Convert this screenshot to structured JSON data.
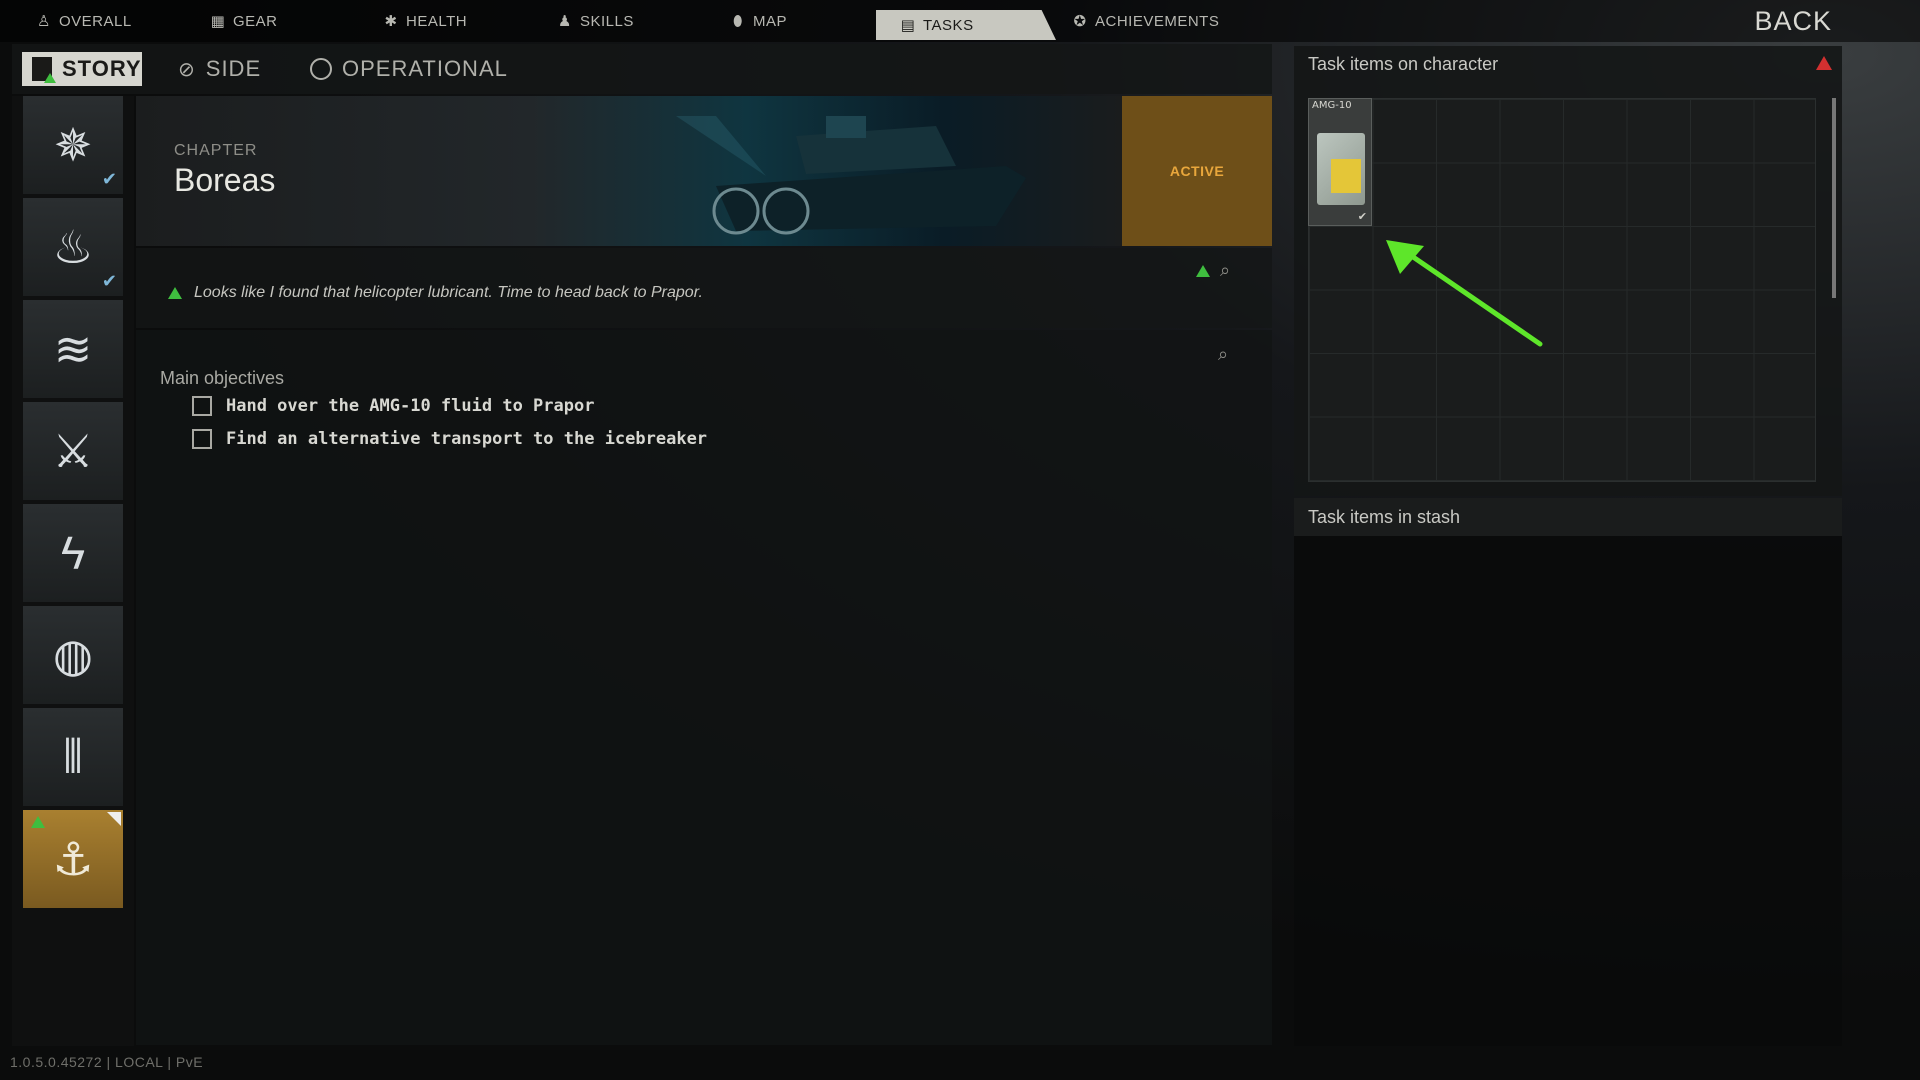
{
  "topnav": {
    "tabs": [
      {
        "label": "OVERALL",
        "icon": "person-icon"
      },
      {
        "label": "GEAR",
        "icon": "gear-vest-icon"
      },
      {
        "label": "HEALTH",
        "icon": "health-icon"
      },
      {
        "label": "SKILLS",
        "icon": "skills-icon"
      },
      {
        "label": "MAP",
        "icon": "map-pin-icon"
      },
      {
        "label": "TASKS",
        "icon": "tasks-icon",
        "active": true
      },
      {
        "label": "ACHIEVEMENTS",
        "icon": "achievements-icon"
      }
    ],
    "back_label": "BACK"
  },
  "subtabs": {
    "story": "STORY",
    "side": "SIDE",
    "operational": "OPERATIONAL"
  },
  "sidebar": {
    "traders": [
      {
        "icon": "compass-star-icon",
        "completed": true
      },
      {
        "icon": "flame-icon",
        "completed": true
      },
      {
        "icon": "wave-icon"
      },
      {
        "icon": "crossed-axes-icon"
      },
      {
        "icon": "lightning-icon"
      },
      {
        "icon": "globe-icon"
      },
      {
        "icon": "signal-icon"
      },
      {
        "icon": "anchor-wings-icon",
        "selected": true,
        "alert": true
      }
    ]
  },
  "chapter": {
    "label": "CHAPTER",
    "name": "Boreas",
    "status": "ACTIVE"
  },
  "note": {
    "text": "Looks like I found that helicopter lubricant. Time to head back to Prapor."
  },
  "objectives": {
    "title": "Main objectives",
    "items": [
      "Hand over the AMG-10 fluid to Prapor",
      "Find an alternative transport to the icebreaker"
    ]
  },
  "character_panel": {
    "title": "Task items on character",
    "item_label": "AMG-10"
  },
  "stash_panel": {
    "title": "Task items in stash"
  },
  "footer": {
    "version": "1.0.5.0.45272 | LOCAL | PvE"
  },
  "colors": {
    "accent_active": "#e9a73c",
    "alert_green": "#3fbe3f",
    "alert_red": "#d23030",
    "arrow_green": "#5ee62a"
  }
}
